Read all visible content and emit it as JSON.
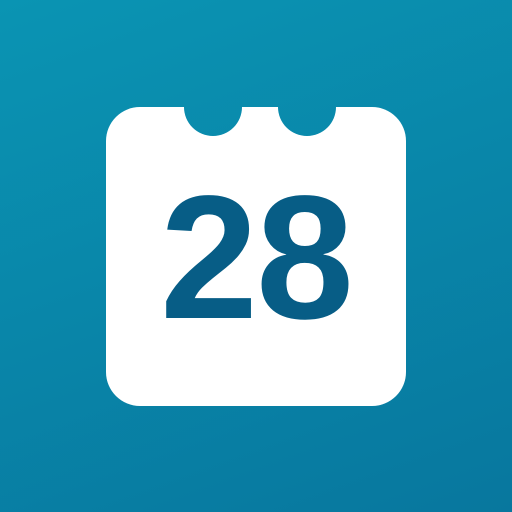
{
  "calendar_icon": {
    "day": "28"
  },
  "colors": {
    "background_top": "#0a94b3",
    "background_bottom": "#08779e",
    "page": "#ffffff",
    "number": "#075d86"
  }
}
